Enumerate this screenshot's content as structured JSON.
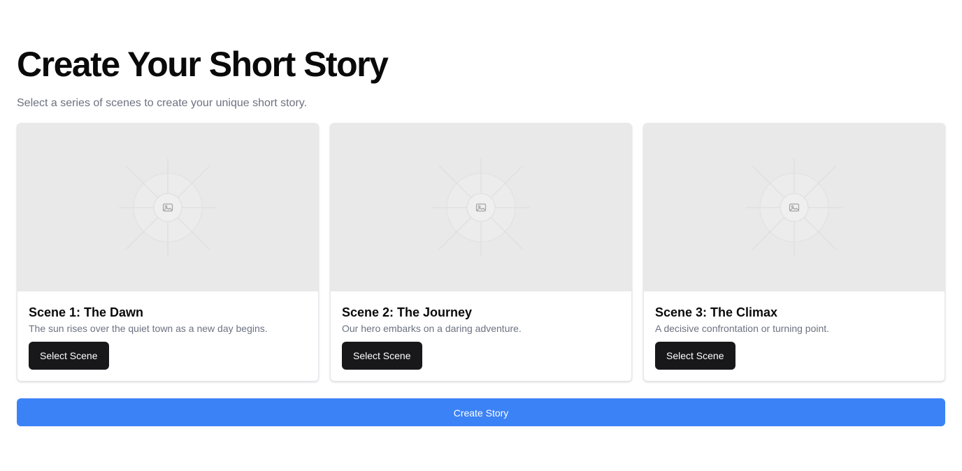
{
  "header": {
    "title": "Create Your Short Story",
    "subtitle": "Select a series of scenes to create your unique short story."
  },
  "scenes": [
    {
      "title": "Scene 1: The Dawn",
      "description": "The sun rises over the quiet town as a new day begins.",
      "button_label": "Select Scene",
      "image_icon": "image-placeholder-icon"
    },
    {
      "title": "Scene 2: The Journey",
      "description": "Our hero embarks on a daring adventure.",
      "button_label": "Select Scene",
      "image_icon": "image-placeholder-icon"
    },
    {
      "title": "Scene 3: The Climax",
      "description": "A decisive confrontation or turning point.",
      "button_label": "Select Scene",
      "image_icon": "image-placeholder-icon"
    }
  ],
  "actions": {
    "create_label": "Create Story"
  },
  "colors": {
    "primary_button": "#3b82f6",
    "dark_button": "#18181b",
    "placeholder_bg": "#e9e9e9",
    "muted_text": "#6b7280"
  }
}
